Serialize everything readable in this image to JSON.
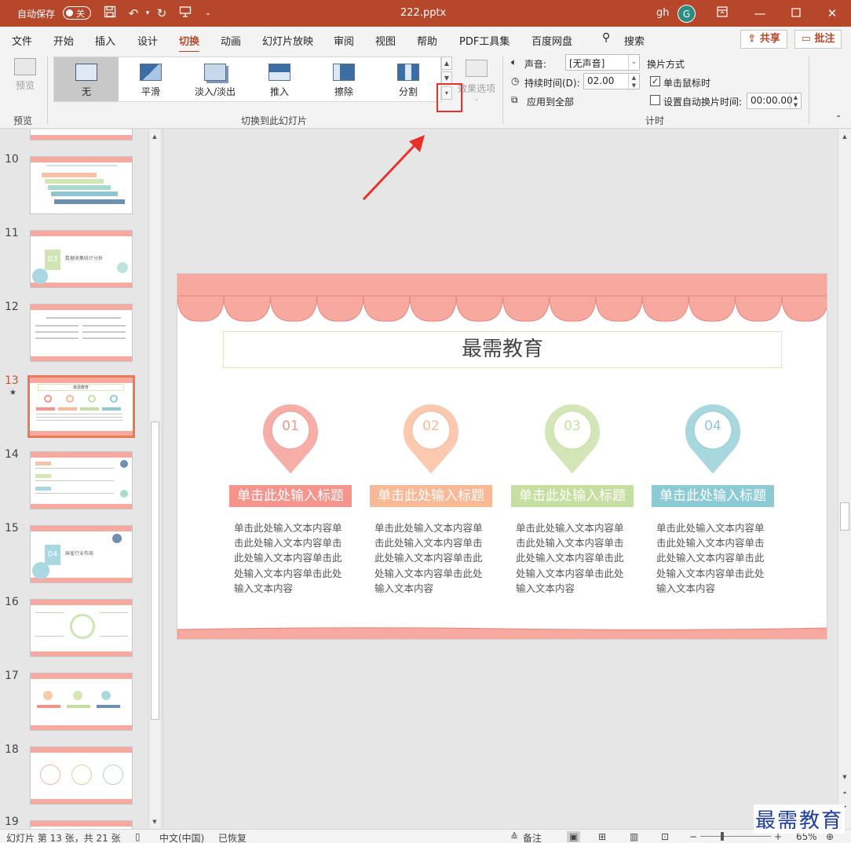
{
  "titlebar": {
    "autosave_label": "自动保存",
    "autosave_state": "关",
    "filename": "222.pptx",
    "user": "gh",
    "avatar_letter": "G"
  },
  "menu": {
    "items": [
      "文件",
      "开始",
      "插入",
      "设计",
      "切换",
      "动画",
      "幻灯片放映",
      "审阅",
      "视图",
      "帮助",
      "PDF工具集",
      "百度网盘"
    ],
    "active": "切换",
    "search": "搜索",
    "share": "共享",
    "comment": "批注"
  },
  "ribbon": {
    "preview_label": "预览",
    "preview_group": "预览",
    "transitions": [
      "无",
      "平滑",
      "淡入/淡出",
      "推入",
      "擦除",
      "分割"
    ],
    "selected_transition": "无",
    "effect_options": "效果选项",
    "transition_group": "切换到此幻灯片",
    "sound_label": "声音:",
    "sound_value": "[无声音]",
    "duration_label": "持续时间(D):",
    "duration_value": "02.00",
    "apply_all": "应用到全部",
    "advance_label": "换片方式",
    "on_click": "单击鼠标时",
    "on_click_checked": true,
    "auto_advance": "设置自动换片时间:",
    "auto_advance_checked": false,
    "auto_time": "00:00.00",
    "timing_group": "计时"
  },
  "thumbnails": {
    "numbers": [
      "10",
      "11",
      "12",
      "13",
      "14",
      "15",
      "16",
      "17",
      "18",
      "19"
    ],
    "current": "13",
    "star": "★",
    "thumb11_num": "03",
    "thumb11_text": "数据收集统计分析",
    "thumb15_num": "04",
    "thumb15_text": "麻雀行业布局",
    "thumb13_title": "最需教育"
  },
  "slide": {
    "title": "最需教育",
    "items": [
      {
        "num": "01",
        "tag": "单击此处输入标题",
        "desc": "单击此处输入文本内容单击此处输入文本内容单击此处输入文本内容单击此处输入文本内容单击此处输入文本内容",
        "color": "#f4948c"
      },
      {
        "num": "02",
        "tag": "单击此处输入标题",
        "desc": "单击此处输入文本内容单击此处输入文本内容单击此处输入文本内容单击此处输入文本内容单击此处输入文本内容",
        "color": "#f9b896"
      },
      {
        "num": "03",
        "tag": "单击此处输入标题",
        "desc": "单击此处输入文本内容单击此处输入文本内容单击此处输入文本内容单击此处输入文本内容单击此处输入文本内容",
        "color": "#c6dea0"
      },
      {
        "num": "04",
        "tag": "单击此处输入标题",
        "desc": "单击此处输入文本内容单击此处输入文本内容单击此处输入文本内容单击此处输入文本内容单击此处输入文本内容",
        "color": "#8ccbd3"
      }
    ]
  },
  "status": {
    "slide_info": "幻灯片 第 13 张，共 21 张",
    "language": "中文(中国)",
    "recovered": "已恢复",
    "notes": "备注",
    "zoom": "65%"
  },
  "watermark": "最需教育",
  "colors": {
    "accent": "#b7472a",
    "highlight_box": "#e8312a",
    "scallop": "#f7a9a0"
  }
}
